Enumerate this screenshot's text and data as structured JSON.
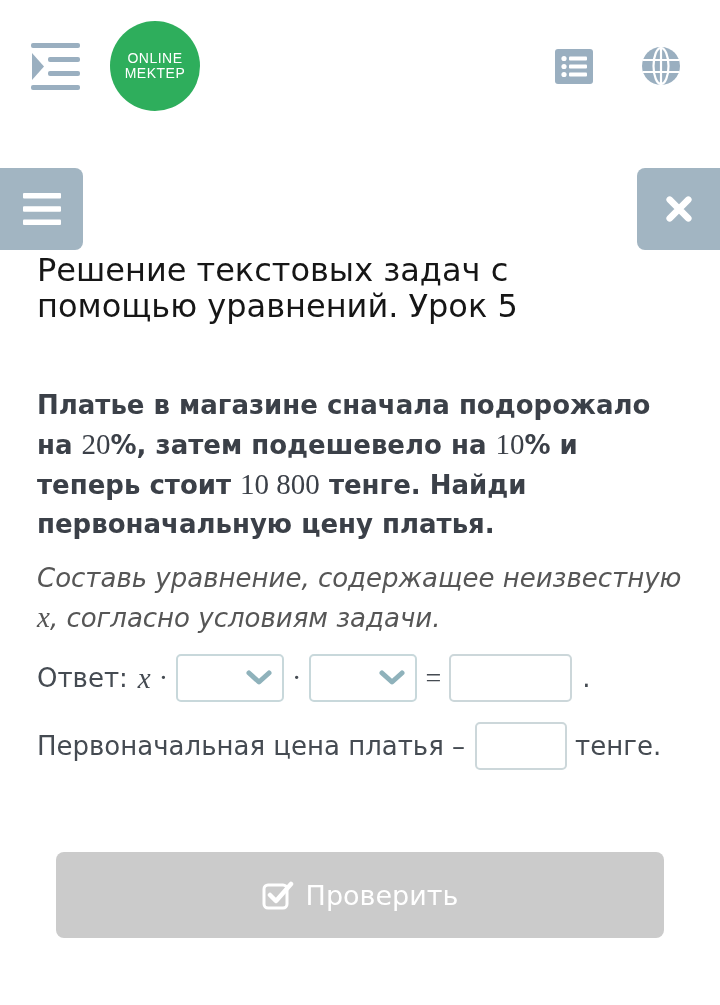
{
  "header": {
    "logo": {
      "lines": [
        "ONLINE",
        "MEKTEP"
      ]
    }
  },
  "title": "Решение текстовых задач с помощью уравнений. Урок 5",
  "problem": {
    "question": [
      {
        "kind": "text",
        "text": "Платье в магазине сначала подорожало на "
      },
      {
        "kind": "math",
        "text": "20"
      },
      {
        "kind": "text",
        "text": "%, затем подешевело на "
      },
      {
        "kind": "math",
        "text": "10"
      },
      {
        "kind": "text",
        "text": "% и теперь стоит "
      },
      {
        "kind": "math",
        "text": "10 800"
      },
      {
        "kind": "text",
        "text": " тенге. Найди первоначальную цену платья."
      }
    ],
    "instruction": [
      {
        "kind": "text",
        "text": "Составь уравнение, содержащее неизвестную "
      },
      {
        "kind": "variable",
        "text": "x"
      },
      {
        "kind": "text",
        "text": ", согласно условиям задачи."
      }
    ]
  },
  "answer": {
    "rows": [
      {
        "parts": [
          {
            "kind": "text",
            "text": "Ответ:"
          },
          {
            "kind": "variable",
            "text": "x"
          },
          {
            "kind": "operator",
            "text": "·"
          },
          {
            "kind": "dropdown"
          },
          {
            "kind": "operator",
            "text": "·"
          },
          {
            "kind": "dropdown"
          },
          {
            "kind": "operator",
            "text": "="
          },
          {
            "kind": "input"
          },
          {
            "kind": "text",
            "text": "."
          }
        ]
      },
      {
        "parts": [
          {
            "kind": "text",
            "text": "Первоначальная цена платья –"
          },
          {
            "kind": "input"
          },
          {
            "kind": "text",
            "text": "тенге."
          }
        ]
      }
    ]
  },
  "check_button": {
    "label": "Проверить",
    "disabled": true
  }
}
